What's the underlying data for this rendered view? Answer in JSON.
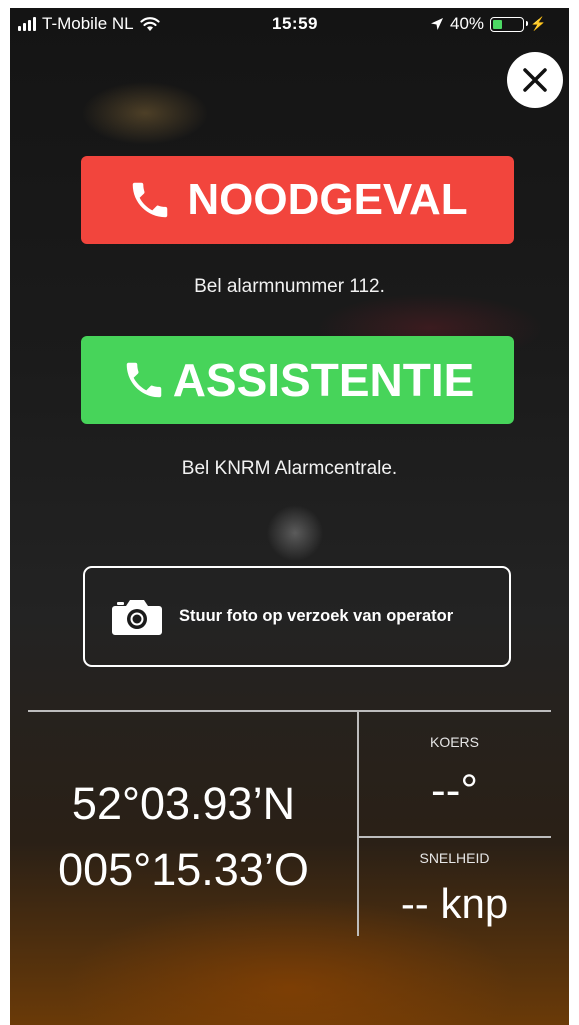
{
  "status_bar": {
    "carrier": "T-Mobile NL",
    "time": "15:59",
    "battery_percent": "40%",
    "battery_level": 0.4,
    "icons": [
      "signal-bars-icon",
      "wifi-icon",
      "location-arrow-icon",
      "battery-icon",
      "charging-bolt-icon"
    ]
  },
  "close_icon": "close-icon",
  "emergency": {
    "label": "NOODGEVAL",
    "caption": "Bel alarmnummer 112.",
    "color": "#f2453d",
    "icon": "phone-icon"
  },
  "assistance": {
    "label": "ASSISTENTIE",
    "caption": "Bel KNRM Alarmcentrale.",
    "color": "#47d45a",
    "icon": "phone-icon"
  },
  "photo": {
    "label": "Stuur foto op verzoek van operator",
    "icon": "camera-icon"
  },
  "navigation": {
    "latitude": "52°03.93’N",
    "longitude": "005°15.33’O",
    "koers_label": "KOERS",
    "koers_value": "--°",
    "snelheid_label": "SNELHEID",
    "snelheid_value": "-- knp"
  }
}
